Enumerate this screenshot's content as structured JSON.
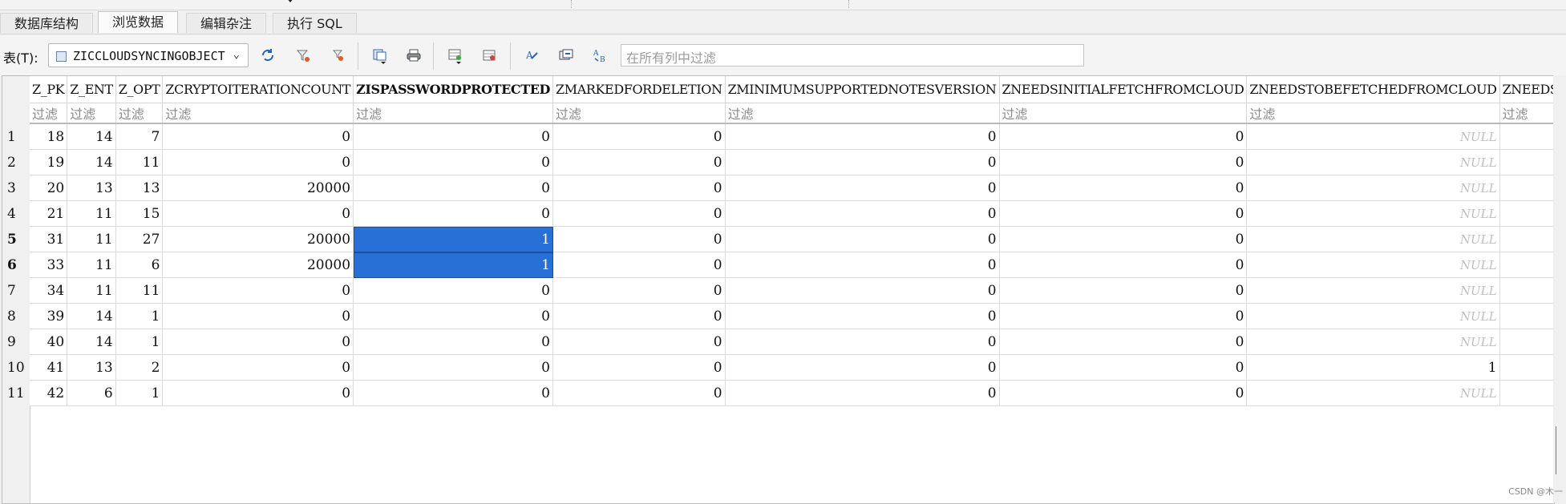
{
  "tabs": [
    {
      "label": "数据库结构"
    },
    {
      "label": "浏览数据"
    },
    {
      "label": "编辑杂注"
    },
    {
      "label": "执行 SQL"
    }
  ],
  "toolbar": {
    "table_label": "表(T):",
    "table_value": "ZICCLOUDSYNCINGOBJECT",
    "filter_placeholder": "在所有列中过滤",
    "icons": [
      "refresh-icon",
      "clear-filters-icon",
      "save-filter-icon",
      "copy-icon",
      "print-icon",
      "insert-record-icon",
      "delete-record-icon",
      "find-icon",
      "find-replace-icon",
      "goto-icon"
    ]
  },
  "grid": {
    "columns": [
      "Z_PK",
      "Z_ENT",
      "Z_OPT",
      "ZCRYPTOITERATIONCOUNT",
      "ZISPASSWORDPROTECTED",
      "ZMARKEDFORDELETION",
      "ZMINIMUMSUPPORTEDNOTESVERSION",
      "ZNEEDSINITIALFETCHFROMCLOUD",
      "ZNEEDSTOBEFETCHEDFROMCLOUD",
      "ZNEEDSTOSAVEU"
    ],
    "filter_label": "过滤",
    "row_numbers": [
      "1",
      "2",
      "3",
      "4",
      "5",
      "6",
      "7",
      "8",
      "9",
      "10",
      "11"
    ],
    "rows": [
      [
        "18",
        "14",
        "7",
        "0",
        "0",
        "0",
        "0",
        "0",
        "NULL",
        ""
      ],
      [
        "19",
        "14",
        "11",
        "0",
        "0",
        "0",
        "0",
        "0",
        "NULL",
        ""
      ],
      [
        "20",
        "13",
        "13",
        "20000",
        "0",
        "0",
        "0",
        "0",
        "NULL",
        ""
      ],
      [
        "21",
        "11",
        "15",
        "0",
        "0",
        "0",
        "0",
        "0",
        "NULL",
        ""
      ],
      [
        "31",
        "11",
        "27",
        "20000",
        "1",
        "0",
        "0",
        "0",
        "NULL",
        ""
      ],
      [
        "33",
        "11",
        "6",
        "20000",
        "1",
        "0",
        "0",
        "0",
        "NULL",
        ""
      ],
      [
        "34",
        "11",
        "11",
        "0",
        "0",
        "0",
        "0",
        "0",
        "NULL",
        ""
      ],
      [
        "39",
        "14",
        "1",
        "0",
        "0",
        "0",
        "0",
        "0",
        "NULL",
        ""
      ],
      [
        "40",
        "14",
        "1",
        "0",
        "0",
        "0",
        "0",
        "0",
        "NULL",
        ""
      ],
      [
        "41",
        "13",
        "2",
        "0",
        "0",
        "0",
        "0",
        "0",
        "1",
        ""
      ],
      [
        "42",
        "6",
        "1",
        "0",
        "0",
        "0",
        "0",
        "0",
        "NULL",
        ""
      ]
    ],
    "selected_column": "ZISPASSWORDPROTECTED",
    "selected_rows": [
      "5",
      "6"
    ],
    "selection_color": "#2870d6"
  },
  "watermark": "CSDN @木一"
}
